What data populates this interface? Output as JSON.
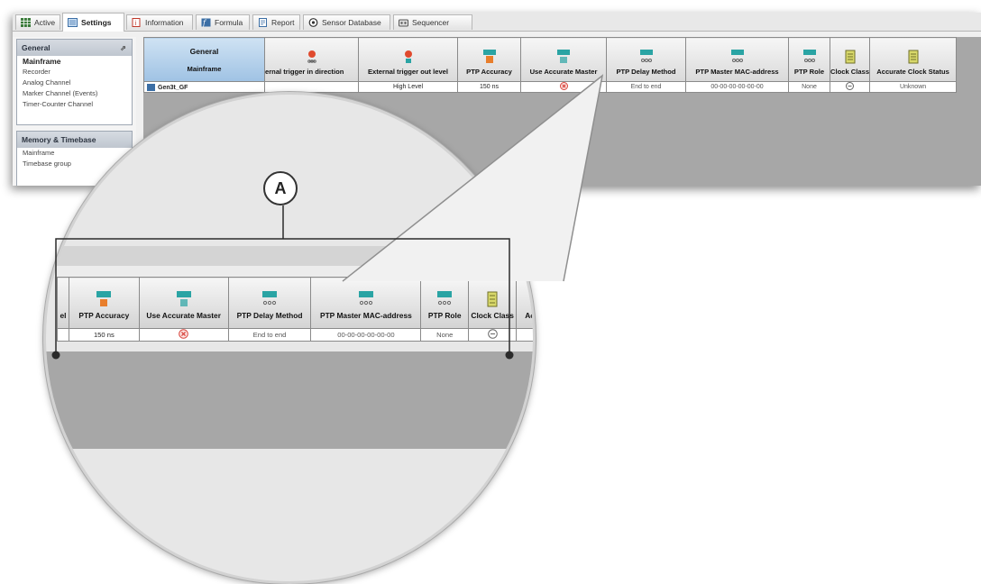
{
  "tabs": [
    {
      "label": "Active",
      "icon": "active-grid-icon"
    },
    {
      "label": "Settings",
      "icon": "settings-icon",
      "active": true
    },
    {
      "label": "Information",
      "icon": "information-icon"
    },
    {
      "label": "Formula",
      "icon": "formula-icon"
    },
    {
      "label": "Report",
      "icon": "report-icon"
    },
    {
      "label": "Sensor Database",
      "icon": "sensor-database-icon"
    },
    {
      "label": "Sequencer",
      "icon": "sequencer-icon"
    }
  ],
  "sidebar": {
    "general": {
      "title": "General",
      "items": [
        "Mainframe",
        "Recorder",
        "Analog Channel",
        "Marker Channel (Events)",
        "Timer-Counter Channel"
      ]
    },
    "memory": {
      "title": "Memory & Timebase",
      "items": [
        "Mainframe",
        "Timebase group"
      ]
    }
  },
  "grid": {
    "general_header": {
      "top": "General",
      "bottom": "Mainframe"
    },
    "columns": [
      "ernal trigger in direction",
      "External trigger out level",
      "PTP Accuracy",
      "Use Accurate Master",
      "PTP Delay Method",
      "PTP Master MAC-address",
      "PTP Role",
      "Clock Class",
      "Accurate Clock Status"
    ],
    "row": {
      "name": "Gen3t_GF",
      "values": [
        "",
        "High Level",
        "150 ns",
        "",
        "End to end",
        "00-00-00-00-00-00",
        "None",
        "",
        "Unknown"
      ]
    }
  },
  "zoom": {
    "columns": [
      "el",
      "PTP Accuracy",
      "Use Accurate Master",
      "PTP Delay Method",
      "PTP Master MAC-address",
      "PTP Role",
      "Clock Class",
      "Ac"
    ],
    "row": [
      "",
      "150 ns",
      "",
      "End to end",
      "00-00-00-00-00-00",
      "None",
      "",
      ""
    ]
  },
  "callout": {
    "label": "A"
  },
  "colors": {
    "ptp_accent": "#2aa4a4",
    "error_red": "#d9453d",
    "general_header": "#b6d2ee"
  }
}
